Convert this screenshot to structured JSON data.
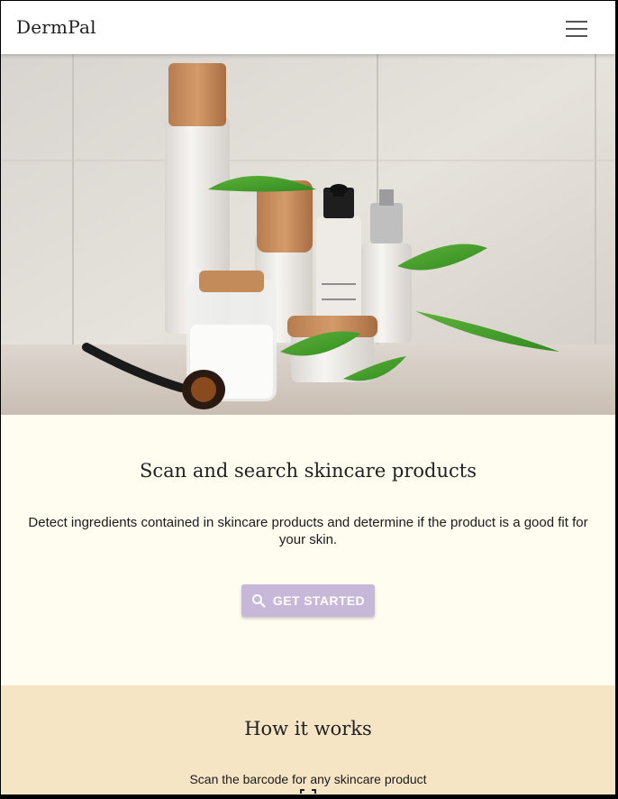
{
  "navbar": {
    "brand": "DermPal",
    "menu_icon": "hamburger-menu-icon"
  },
  "hero": {
    "image": "skincare-products-photo"
  },
  "intro": {
    "title": "Scan and search skincare products",
    "description": "Detect ingredients contained in skincare products and determine if the product is a good fit for your skin.",
    "cta_icon": "search-icon",
    "cta_label": "GET STARTED"
  },
  "how_it_works": {
    "title": "How it works",
    "step_1": "Scan the barcode for any skincare product",
    "step_1_icon": "barcode-scan-icon"
  },
  "colors": {
    "navbar_bg": "#ffffff",
    "intro_bg": "#fffdf0",
    "how_bg": "#f5e5c5",
    "cta_bg": "#c7b7d9"
  }
}
